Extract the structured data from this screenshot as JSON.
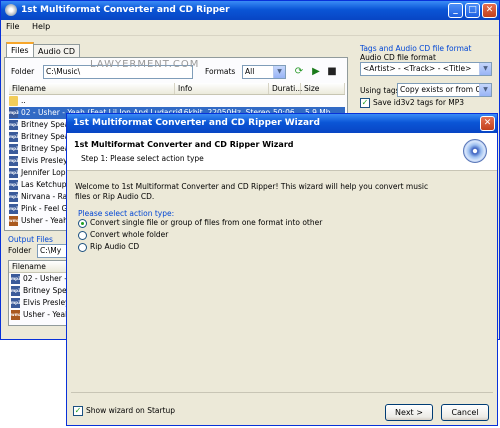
{
  "main_window": {
    "title": "1st Multiformat Converter and CD Ripper",
    "menu": [
      "File",
      "Help"
    ],
    "tabs": [
      "Files",
      "Audio CD"
    ],
    "folder_label": "Folder",
    "folder_value": "C:\\Music\\",
    "formats_label": "Formats",
    "formats_value": "All",
    "watermark": "LAWYERMENT.COM",
    "columns": [
      "Filename",
      "Info",
      "Durati...",
      "Size"
    ],
    "files": [
      {
        "icon": "folder",
        "name": "..",
        "info": "",
        "duration": "",
        "size": ""
      },
      {
        "icon": "mp3",
        "name": "02 - Usher - Yeah (Feat Lil Jon And Ludacris...",
        "info": "16kbit, 22050Hz, Stereo",
        "duration": "50:06",
        "size": "5.9 Mb"
      },
      {
        "icon": "mp3",
        "name": "Britney Spear",
        "info": "",
        "duration": "",
        "size": ""
      },
      {
        "icon": "mp3",
        "name": "Britney Spear",
        "info": "",
        "duration": "",
        "size": ""
      },
      {
        "icon": "mp3",
        "name": "Britney Spear",
        "info": "",
        "duration": "",
        "size": ""
      },
      {
        "icon": "mp3",
        "name": "Elvis Presley",
        "info": "",
        "duration": "",
        "size": ""
      },
      {
        "icon": "mp3",
        "name": "Jennifer Lope",
        "info": "",
        "duration": "",
        "size": ""
      },
      {
        "icon": "mp3",
        "name": "Las Ketchup",
        "info": "",
        "duration": "",
        "size": ""
      },
      {
        "icon": "mp3",
        "name": "Nirvana - Rap",
        "info": "",
        "duration": "",
        "size": ""
      },
      {
        "icon": "mp3",
        "name": "Pink - Feel Go",
        "info": "",
        "duration": "",
        "size": ""
      },
      {
        "icon": "wma",
        "name": "Usher - Yeah",
        "info": "",
        "duration": "",
        "size": ""
      }
    ],
    "output_section": "Output Files",
    "output_folder_label": "Folder",
    "output_folder_value": "C:\\My",
    "output_columns": [
      "Filename"
    ],
    "output_files": [
      {
        "icon": "mp3",
        "name": "02 - Usher - Y"
      },
      {
        "icon": "mp3",
        "name": "Britney Spear"
      },
      {
        "icon": "mp3",
        "name": "Elvis Presley"
      },
      {
        "icon": "wma",
        "name": "Usher - Yeah"
      }
    ],
    "tags": {
      "section": "Tags and Audio CD file format",
      "file_format_label": "Audio CD file format",
      "file_format_value": "<Artist> - <Track> - <Title>",
      "using_tags_label": "Using tags",
      "using_tags_value": "Copy exists or from CD",
      "save_id3_label": "Save id3v2 tags for MP3",
      "save_id3_checked": true
    }
  },
  "wizard": {
    "title": "1st Multiformat Converter and CD Ripper Wizard",
    "heading": "1st Multiformat Converter and CD Ripper Wizard",
    "step": "Step 1: Please select action type",
    "welcome_line1": "Welcome to 1st Multiformat Converter and CD Ripper! This wizard will help you convert music",
    "welcome_line2": "files or Rip Audio CD.",
    "select_label": "Please select action type:",
    "options": [
      {
        "label": "Convert single file or group of files from one format into other",
        "selected": true
      },
      {
        "label": "Convert whole folder",
        "selected": false
      },
      {
        "label": "Rip Audio CD",
        "selected": false
      }
    ],
    "show_wizard_label": "Show wizard on Startup",
    "show_wizard_checked": true,
    "next_button": "Next >",
    "cancel_button": "Cancel"
  }
}
